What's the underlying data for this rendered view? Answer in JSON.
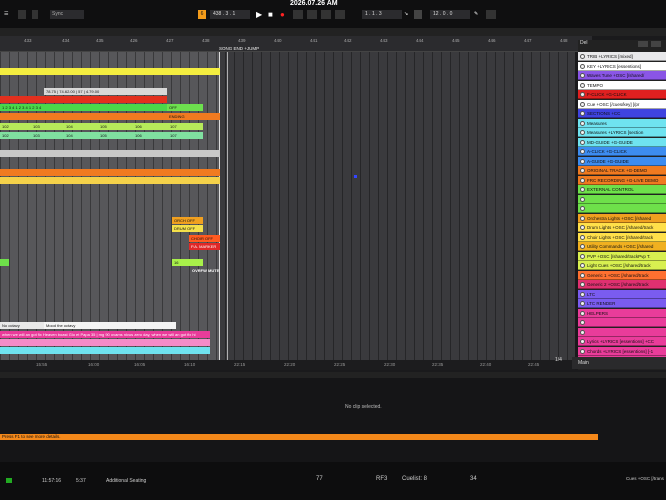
{
  "transport": {
    "title": "2026.07.26 AM",
    "tempo_field": "438 . 3 . 1",
    "position_field": "1 . 1 . 3",
    "loop_field": "12 . 0 . 0",
    "tempo_badge": "6",
    "left_menu": "Sync"
  },
  "ruler": {
    "bars": [
      "433",
      "434",
      "435",
      "426",
      "427",
      "438",
      "439",
      "440",
      "441",
      "442",
      "443",
      "444",
      "445",
      "446",
      "447",
      "448"
    ],
    "locator": "SONG END +JUMP"
  },
  "clips": {
    "r3": [
      "78.75",
      "74.62.00",
      "57",
      "4.79.00"
    ],
    "r5": [
      "1",
      "2",
      "3",
      "4",
      "1",
      "2",
      "3",
      "4",
      "1",
      "2",
      "3",
      "4",
      "1",
      "2",
      "3",
      "4"
    ],
    "r5_label": "OFF",
    "r6_label": "ENDING",
    "r7": [
      "102",
      "103",
      "104",
      "105",
      "106",
      "107"
    ],
    "r8": [
      "102",
      "103",
      "104",
      "105",
      "106",
      "107"
    ],
    "orch_off": "ORCH OFF",
    "drum_off": "DRUM OFF",
    "choir_off": "CHOIR OFF",
    "pa_marker": "P.A. MARKER",
    "ovrfw_mute": "OVRFW MUTE",
    "small_g": "16",
    "lyric_left": "No octavy",
    "lyric_mid": "Mood the octavy",
    "lyric_long": "when we will an got fix Heaven boast Glo et Papa 35 | mg 90 ovams nivus zero day, when we will an got fix hi"
  },
  "timebar": [
    "15:55",
    "16:00",
    "16:05",
    "16:10",
    "22:15",
    "22:20",
    "22:25",
    "22:30",
    "22:35",
    "22:40",
    "22:45"
  ],
  "tracks": [
    {
      "name": "TRIB +LYRICS [mixed]",
      "color": "#e8e8ea"
    },
    {
      "name": "KEY +LYRICS [essentions]",
      "color": "#ffffff"
    },
    {
      "name": "Waves Tune +OSC [/shared/",
      "color": "#8a55e6"
    },
    {
      "name": "TEMPO",
      "color": "#ffffff"
    },
    {
      "name": "F-CLICK +G-CLICK",
      "color": "#e02020"
    },
    {
      "name": "Cue +OSC [/cues/key] [/pr",
      "color": "#ffffff"
    },
    {
      "name": "SECTIONS +CC",
      "color": "#3f43e0"
    },
    {
      "name": "Measures",
      "color": "#6fe3f0"
    },
    {
      "name": "Measures +LYRICS [section",
      "color": "#6fe3f0"
    },
    {
      "name": "MD-GUIDE +G-GUIDE",
      "color": "#6fe3f0"
    },
    {
      "name": "A-CLICK +G-CLICK",
      "color": "#3d8cf0"
    },
    {
      "name": "A-GUIDE +G-GUIDE",
      "color": "#3d8cf0"
    },
    {
      "name": "ORIGINAL TRACK +G-DEMO",
      "color": "#f07a20"
    },
    {
      "name": "FRC RECORDING +G-LIVE DEMO",
      "color": "#f07a20"
    },
    {
      "name": "EXTERNAL CONTROL",
      "color": "#6ee04a"
    },
    {
      "name": "",
      "color": "#6ee04a"
    },
    {
      "name": "",
      "color": "#6ee04a"
    },
    {
      "name": "Orchestra Lights +OSC [/shared",
      "color": "#f0a020"
    },
    {
      "name": "Drum Lights +OSC [/shared/track",
      "color": "#ffe04a"
    },
    {
      "name": "Choir Lights +OSC [/shared/track",
      "color": "#ffe04a"
    },
    {
      "name": "Utility Commands +OSC [/shared",
      "color": "#f0b020"
    },
    {
      "name": "PVP +OSC [/shared/trackPvp T.",
      "color": "#d8f050"
    },
    {
      "name": "Light Cues +OSC [/shared/track",
      "color": "#d8f050"
    },
    {
      "name": "Generic 1 +OSC [/shared/track",
      "color": "#ff7030"
    },
    {
      "name": "Generic 2 +OSC [/shared/track",
      "color": "#e03070"
    },
    {
      "name": "LTC",
      "color": "#7a5cf0"
    },
    {
      "name": "LTC RENDER",
      "color": "#7a5cf0"
    },
    {
      "name": "HELPERS",
      "color": "#e93c9a"
    },
    {
      "name": "",
      "color": "#e93c9a"
    },
    {
      "name": "",
      "color": "#e93c9a"
    },
    {
      "name": "Lyrics +LYRICS [essentions] +CC",
      "color": "#e93c9a"
    },
    {
      "name": "Chords +LYRICS [essentions] [-1",
      "color": "#e93c9a"
    },
    {
      "name": "Lead +LYRICS [essentions] [progr",
      "color": "#e93c9a"
    }
  ],
  "tracks_footer": {
    "main": "Main",
    "ratio": "1/4"
  },
  "detail": {
    "message": "No clip selected.",
    "hint": "Press F1 to see more details."
  },
  "status": {
    "time_a": "11:57:16",
    "time_b": "5:37",
    "status_text": "Additional Seating",
    "n1": "77",
    "n2": "RF3",
    "cuelist": "Cuelist: 8",
    "n3": "34",
    "right": "Cues +OSC [/trans"
  }
}
